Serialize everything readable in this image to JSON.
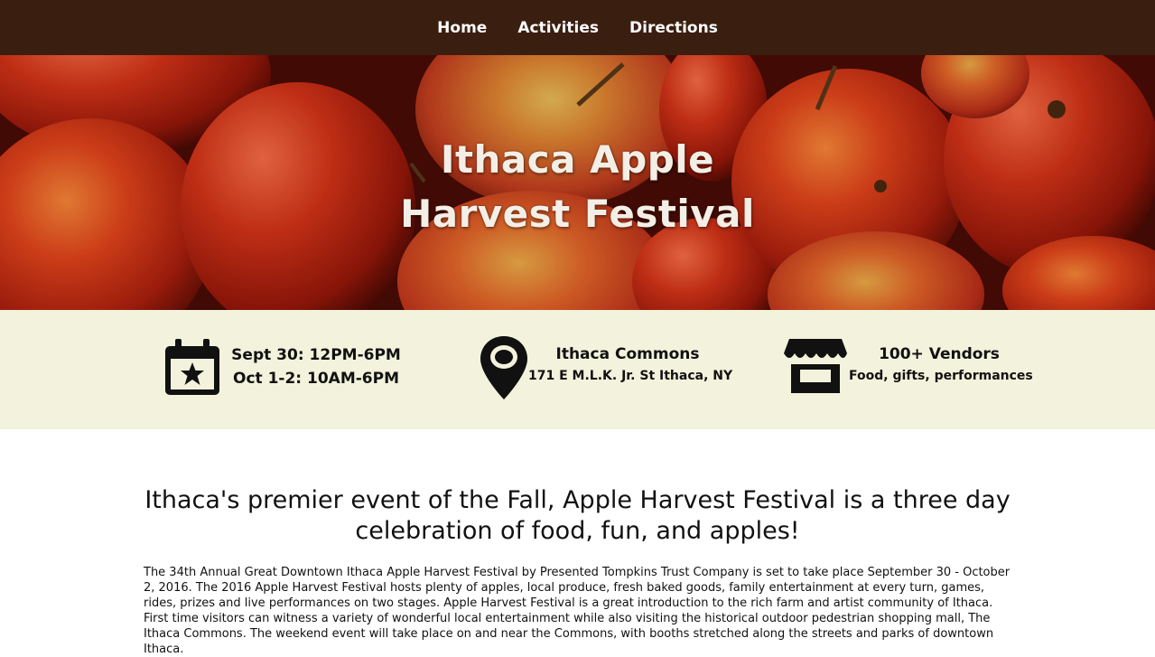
{
  "nav": {
    "items": [
      {
        "label": "Home"
      },
      {
        "label": "Activities"
      },
      {
        "label": "Directions"
      }
    ]
  },
  "hero": {
    "title_line1": "Ithaca Apple",
    "title_line2": "Harvest Festival",
    "background": "apples-photo"
  },
  "info": {
    "dates": {
      "icon": "calendar-star-icon",
      "line1": "Sept 30: 12PM-6PM",
      "line2": "Oct 1-2: 10AM-6PM"
    },
    "location": {
      "icon": "map-pin-icon",
      "line1": "Ithaca Commons",
      "line2": "171 E M.L.K. Jr. St Ithaca, NY"
    },
    "vendors": {
      "icon": "store-icon",
      "line1": "100+ Vendors",
      "line2": "Food, gifts, performances"
    }
  },
  "main": {
    "headline": "Ithaca's premier event of the Fall, Apple Harvest Festival is a three day celebration of food, fun, and apples!",
    "body": "The 34th Annual Great Downtown Ithaca Apple Harvest Festival by Presented Tompkins Trust Company is set to take place September 30 - October 2, 2016. The 2016 Apple Harvest Festival hosts plenty of apples, local produce, fresh baked goods, family entertainment at every turn, games, rides, prizes and live performances on two stages. Apple Harvest Festival is a great introduction to the rich farm and artist community of Ithaca. First time visitors can witness a variety of wonderful local entertainment while also visiting the historical outdoor pedestrian shopping mall, The Ithaca Commons. The weekend event will take place on and near the Commons, with booths stretched along the streets and parks of downtown Ithaca."
  },
  "colors": {
    "nav_bg": "#3a1f10",
    "info_bg": "#f3f2dc",
    "hero_text": "#f3efe6"
  }
}
